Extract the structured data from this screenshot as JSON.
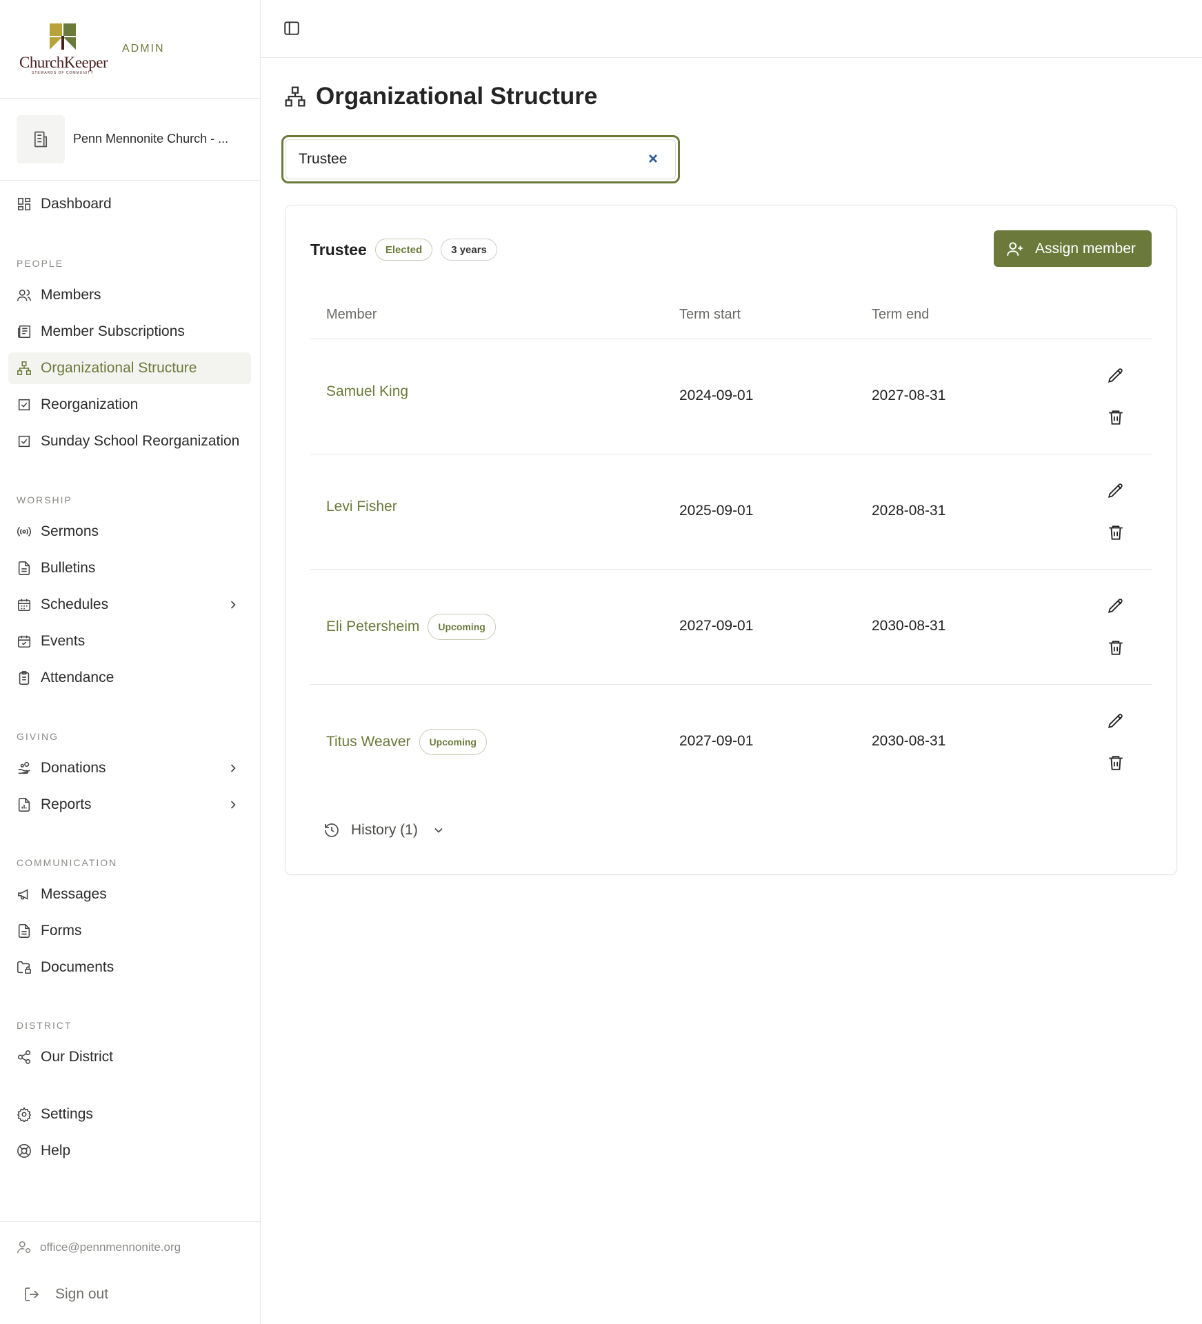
{
  "brand": {
    "logo_text": "ChurchKeeper",
    "logo_tagline": "STEWARDS OF COMMUNITY",
    "admin_label": "ADMIN",
    "colors": {
      "accent": "#6b7a3a",
      "logo_text": "#4a1f1f"
    }
  },
  "org": {
    "name": "Penn Mennonite Church - ..."
  },
  "sidebar": {
    "dashboard": "Dashboard",
    "sections": {
      "people": "PEOPLE",
      "worship": "WORSHIP",
      "giving": "GIVING",
      "communication": "COMMUNICATION",
      "district": "DISTRICT"
    },
    "people": [
      "Members",
      "Member Subscriptions",
      "Organizational Structure",
      "Reorganization",
      "Sunday School Reorganization"
    ],
    "worship": [
      "Sermons",
      "Bulletins",
      "Schedules",
      "Events",
      "Attendance"
    ],
    "giving": [
      "Donations",
      "Reports"
    ],
    "communication": [
      "Messages",
      "Forms",
      "Documents"
    ],
    "district": [
      "Our District"
    ],
    "settings": "Settings",
    "help": "Help",
    "active_item": "Organizational Structure"
  },
  "user": {
    "email": "office@pennmennonite.org",
    "sign_out": "Sign out"
  },
  "page": {
    "title": "Organizational Structure",
    "search": {
      "value": "Trustee"
    }
  },
  "role_card": {
    "title": "Trustee",
    "badges": [
      "Elected",
      "3 years"
    ],
    "assign_button": "Assign member",
    "columns": [
      "Member",
      "Term start",
      "Term end"
    ],
    "rows": [
      {
        "member": "Samuel King",
        "badge": "",
        "start": "2024-09-01",
        "end": "2027-08-31"
      },
      {
        "member": "Levi Fisher",
        "badge": "",
        "start": "2025-09-01",
        "end": "2028-08-31"
      },
      {
        "member": "Eli Petersheim",
        "badge": "Upcoming",
        "start": "2027-09-01",
        "end": "2030-08-31"
      },
      {
        "member": "Titus Weaver",
        "badge": "Upcoming",
        "start": "2027-09-01",
        "end": "2030-08-31"
      }
    ],
    "history_label": "History (1)"
  }
}
